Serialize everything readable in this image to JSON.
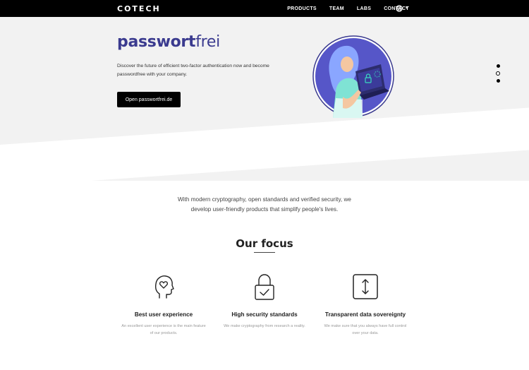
{
  "nav": {
    "logo": "COTECH",
    "items": [
      "PRODUCTS",
      "TEAM",
      "LABS",
      "CONTACT"
    ],
    "language_icon": "globe-icon"
  },
  "hero": {
    "brand_part1": "passwort",
    "brand_part2": "frei",
    "description": "Discover the future of efficient two-factor authentication now and become passwordfree with your company.",
    "cta_label": "Open passwortfrei.de",
    "colors": {
      "brand": "#3b3b8f",
      "illustration_bg": "#5656c8",
      "accent": "#3ad9c0"
    }
  },
  "mission": {
    "line1": "With modern cryptography, open standards and verified security, we",
    "line2": "develop user-friendly products that simplify people's lives."
  },
  "focus": {
    "title": "Our focus",
    "features": [
      {
        "icon": "head-heart-icon",
        "title": "Best user experience",
        "desc_line1": "An excellent user experience is the main feature",
        "desc_line2": "of our products."
      },
      {
        "icon": "lock-check-icon",
        "title": "High security standards",
        "desc_line1": "We make cryptography from research a reality.",
        "desc_line2": ""
      },
      {
        "icon": "vertical-arrows-icon",
        "title": "Transparent data sovereignty",
        "desc_line1": "We make sure that you always have full control",
        "desc_line2": "over your data."
      }
    ]
  }
}
